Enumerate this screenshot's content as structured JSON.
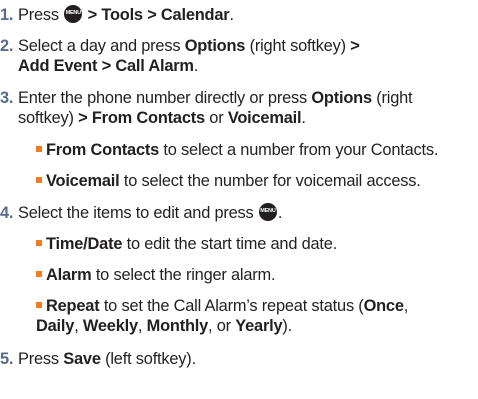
{
  "menu_icon": {
    "top": "MENU",
    "bottom": "OK"
  },
  "steps": [
    {
      "num": "1.",
      "lines": [
        {
          "a": "Press",
          "b": "> Tools > Calendar",
          "c": "."
        }
      ]
    },
    {
      "num": "2.",
      "lines": [
        {
          "a": "Select a day and press ",
          "b": "Options",
          "c": " (right softkey) ",
          "d": ">"
        },
        {
          "b": "Add Event > Call Alarm",
          "c": "."
        }
      ]
    },
    {
      "num": "3.",
      "lines": [
        {
          "a": "Enter the phone number directly or press ",
          "b": "Options",
          "c": " (right"
        },
        {
          "a": "softkey) ",
          "b": "> From Contacts",
          "c": " or ",
          "d": "Voicemail",
          "e": "."
        }
      ],
      "bullets": [
        {
          "b": "From Contacts",
          "c": " to select a number from your Contacts."
        },
        {
          "b": "Voicemail",
          "c": " to select the number for voicemail access."
        }
      ]
    },
    {
      "num": "4.",
      "lines": [
        {
          "a": "Select the items to edit and press",
          "c": "."
        }
      ],
      "bullets": [
        {
          "b": "Time/Date",
          "c": " to edit the start time and date."
        },
        {
          "b": "Alarm",
          "c": " to select the ringer alarm."
        },
        {
          "b": "Repeat",
          "c": " to set the Call Alarm’s repeat status (",
          "d": "Once",
          "e": ","
        }
      ],
      "cont": {
        "b": "Daily",
        "c": ", ",
        "d": "Weekly",
        "e": ", ",
        "f": "Monthly",
        "g": ", or ",
        "h": "Yearly",
        "i": ")."
      }
    },
    {
      "num": "5.",
      "lines": [
        {
          "a": "Press ",
          "b": "Save",
          "c": " (left softkey)."
        }
      ]
    }
  ]
}
